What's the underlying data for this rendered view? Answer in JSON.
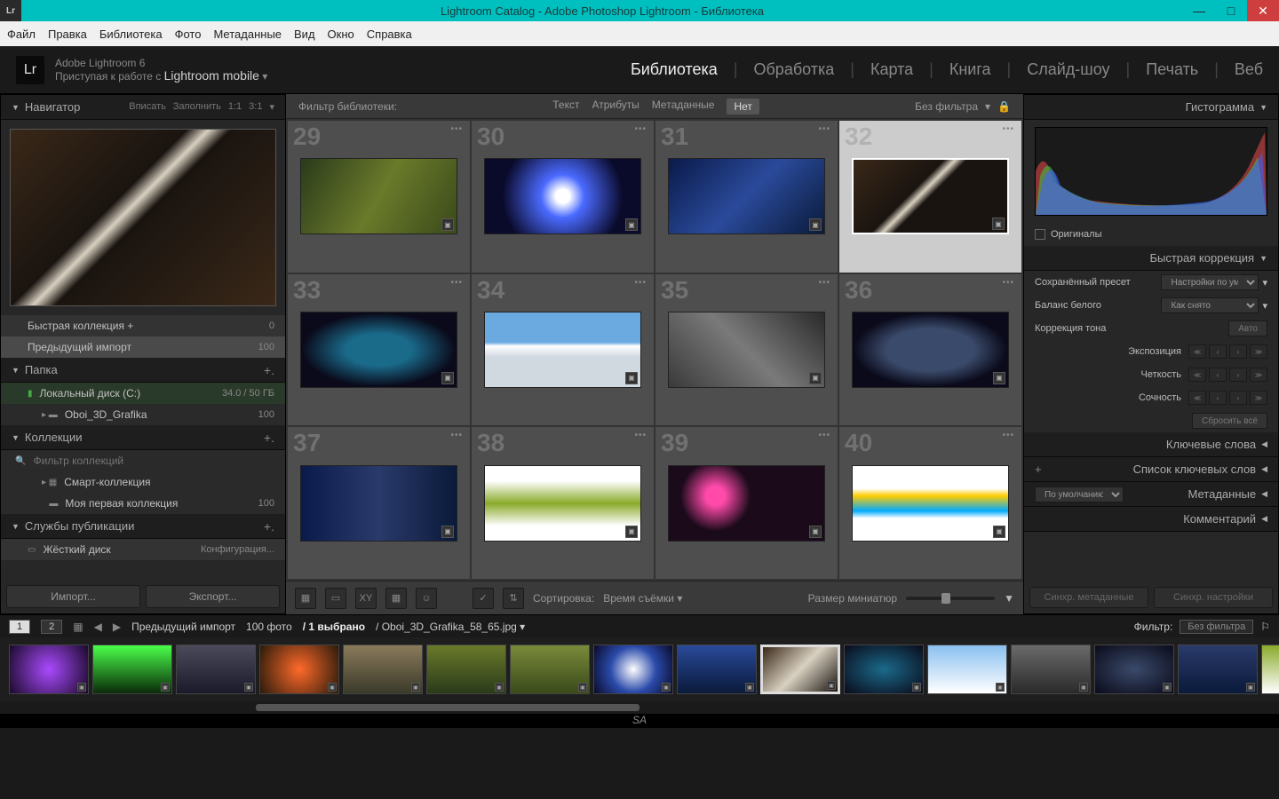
{
  "titlebar": {
    "icon": "Lr",
    "text": "Lightroom Catalog - Adobe Photoshop Lightroom - Библиотека"
  },
  "menu": [
    "Файл",
    "Правка",
    "Библиотека",
    "Фото",
    "Метаданные",
    "Вид",
    "Окно",
    "Справка"
  ],
  "identity": {
    "version": "Adobe Lightroom 6",
    "tagline_pre": "Приступая к работе с ",
    "tagline_mob": "Lightroom mobile"
  },
  "modules": [
    "Библиотека",
    "Обработка",
    "Карта",
    "Книга",
    "Слайд-шоу",
    "Печать",
    "Веб"
  ],
  "navigator": {
    "title": "Навигатор",
    "opts": [
      "Вписать",
      "Заполнить",
      "1:1",
      "3:1"
    ]
  },
  "catalog": {
    "quick": "Быстрая коллекция  +",
    "quick_ct": "0",
    "prev": "Предыдущий импорт",
    "prev_ct": "100"
  },
  "folders": {
    "title": "Папка",
    "drive": "Локальный диск (C:)",
    "drive_ct": "34.0 / 50 ГБ",
    "folder": "Oboi_3D_Grafika",
    "folder_ct": "100"
  },
  "collections": {
    "title": "Коллекции",
    "filter_ph": "Фильтр коллекций",
    "smart": "Смарт-коллекция",
    "mine": "Моя первая коллекция",
    "mine_ct": "100"
  },
  "publish": {
    "title": "Службы публикации",
    "hdd": "Жёсткий диск",
    "config": "Конфигурация..."
  },
  "buttons": {
    "import": "Импорт...",
    "export": "Экспорт..."
  },
  "filter_bar": {
    "title": "Фильтр библиотеки:",
    "tabs": [
      "Текст",
      "Атрибуты",
      "Метаданные",
      "Нет"
    ],
    "none": "Без фильтра"
  },
  "grid_start": 29,
  "grid_selected": 32,
  "thumbs": [
    "linear-gradient(120deg,#2a3a1a,#6a7a2a,#3a4a1a)",
    "radial-gradient(circle,#fff 8%,#4a6aff 25%,#0a0a2a 70%)",
    "linear-gradient(135deg,#0a1a4a,#2a4a9a,#0a1a3a)",
    "linear-gradient(135deg,#3a2818,#1a1410 40%,#d8d0c0 45%,#1a1410 50%)",
    "radial-gradient(ellipse at center,#1a6a8a 30%,#0a0a1a 70%)",
    "linear-gradient(to bottom,#6aaae0 40%,#fff 45%,#d0d8e0 60%)",
    "linear-gradient(45deg,#3a3a3a,#7a7a7a,#2a2a2a)",
    "radial-gradient(ellipse,#3a4a6a 40%,#0a0a1a 70%)",
    "linear-gradient(to right,#0a1a4a,#2a3a6a,#0a1a3a)",
    "linear-gradient(to bottom,#fff 20%,#8aaa2a 50%,#fff 80%)",
    "radial-gradient(circle at 30% 40%,#ff4aaa 8%,#1a0a1a 30%)",
    "linear-gradient(to bottom,#fff 30%,#ffcc00 40%,#00aaff 60%,#fff 70%)"
  ],
  "toolbar": {
    "sort": "Сортировка:",
    "sort_val": "Время съёмки",
    "size": "Размер миниатюр"
  },
  "right": {
    "histogram": "Гистограмма",
    "originals": "Оригиналы",
    "quick_dev": "Быстрая коррекция",
    "preset_lbl": "Сохранённый пресет",
    "preset_val": "Настройки по ум...",
    "wb_lbl": "Баланс белого",
    "wb_val": "Как снято",
    "tone_lbl": "Коррекция тона",
    "auto": "Авто",
    "exposure": "Экспозиция",
    "clarity": "Четкость",
    "vibrance": "Сочность",
    "reset": "Сбросить всё",
    "keywords": "Ключевые слова",
    "keyword_list": "Список ключевых слов",
    "metadata": "Метаданные",
    "meta_val": "По умолчанию",
    "comments": "Комментарий",
    "sync_meta": "Синхр. метаданные",
    "sync_set": "Синхр. настройки"
  },
  "pathbar": {
    "source": "Предыдущий импорт",
    "count": "100 фото",
    "sel": "/ 1 выбрано",
    "file": "/ Oboi_3D_Grafika_58_65.jpg",
    "filter": "Фильтр:",
    "filter_val": "Без фильтра"
  },
  "film_thumbs": [
    "radial-gradient(circle,#aa4aff,#1a0a2a)",
    "linear-gradient(#4aff4a,#0a2a0a)",
    "linear-gradient(#4a4a5a,#1a1a2a)",
    "radial-gradient(circle,#ff6a2a,#2a1a0a)",
    "linear-gradient(#8a7a5a,#3a3a2a)",
    "linear-gradient(#6a7a2a,#2a3a1a)",
    "linear-gradient(#7a8a3a,#3a4a1a)",
    "radial-gradient(circle,#fff,#2a4aaa,#0a0a2a)",
    "linear-gradient(#2a4a9a,#0a1a3a)",
    "linear-gradient(135deg,#3a2818,#d8d0c0,#1a1410)",
    "radial-gradient(ellipse,#1a6a8a,#0a0a1a)",
    "linear-gradient(#8ac0f0,#fff)",
    "linear-gradient(#6a6a6a,#2a2a2a)",
    "radial-gradient(ellipse,#3a4a6a,#0a0a1a)",
    "linear-gradient(#2a3a6a,#0a1a3a)",
    "linear-gradient(#8aaa2a,#fff)",
    "radial-gradient(circle,#ff4aaa,#1a0a1a)",
    "linear-gradient(#ff4aff,#2a0a2a)"
  ],
  "film_selected": 9,
  "sa": "SA"
}
